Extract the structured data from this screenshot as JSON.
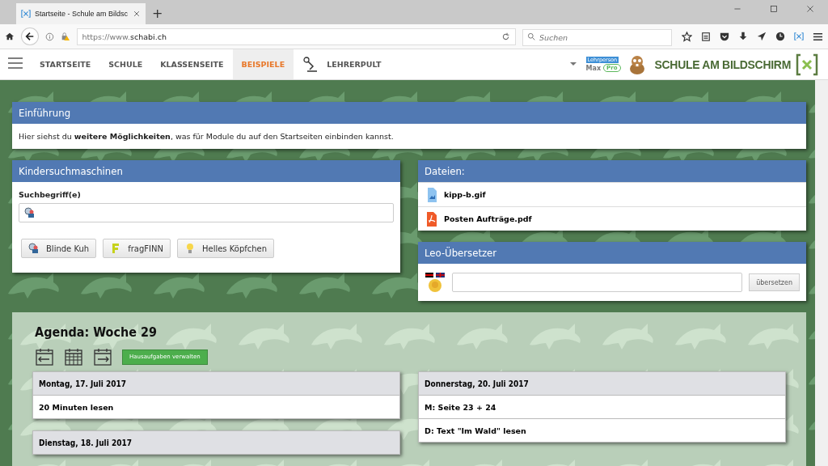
{
  "browser": {
    "tab_title": "Startseite - Schule am Bildsc",
    "new_tab": "+",
    "url_prefix": "https://www.",
    "url_host": "schabi.ch",
    "search_placeholder": "Suchen"
  },
  "nav": {
    "items": [
      {
        "label": "STARTSEITE",
        "selected": false,
        "kind": "link"
      },
      {
        "label": "SCHULE",
        "selected": false,
        "kind": "link"
      },
      {
        "label": "KLASSENSEITE",
        "selected": false,
        "kind": "link"
      },
      {
        "label": "BEISPIELE",
        "selected": true,
        "kind": "link"
      },
      {
        "label": "LEHRERPULT",
        "selected": false,
        "kind": "tool"
      }
    ],
    "user_role": "Lehrperson",
    "user_name": "Max",
    "user_badge": "Pro",
    "logo_text": "SCHULE AM BILDSCHIRM"
  },
  "intro": {
    "title": "Einführung",
    "text": "Hier siehst du **weitere Möglichkeiten**, was für Module du auf den Startseiten einbinden kannst."
  },
  "search_card": {
    "title": "Kindersuchmaschinen",
    "label": "Suchbegriff(e)",
    "buttons": [
      {
        "label": "Blinde Kuh",
        "kind": "kuh"
      },
      {
        "label": "fragFINN",
        "kind": "finn"
      },
      {
        "label": "Helles Köpfchen",
        "kind": "bulb"
      }
    ]
  },
  "files": {
    "title": "Dateien:",
    "items": [
      {
        "name": "kipp-b.gif",
        "kind": "image"
      },
      {
        "name": "Posten Aufträge.pdf",
        "kind": "pdf"
      }
    ]
  },
  "leo": {
    "title": "Leo-Übersetzer",
    "button": "übersetzen"
  },
  "agenda": {
    "title": "Agenda: Woche 29",
    "manage_button": "Hausaufgaben verwalten",
    "columns": [
      [
        {
          "date": "Montag, 17. Juli 2017",
          "entries": [
            "20 Minuten lesen"
          ]
        },
        {
          "date": "Dienstag, 18. Juli 2017"
        }
      ],
      [
        {
          "date": "Donnerstag, 20. Juli 2017",
          "entries": [
            "M: Seite 23 + 24",
            "D: Text \"Im Wald\" lesen"
          ]
        }
      ]
    ]
  }
}
